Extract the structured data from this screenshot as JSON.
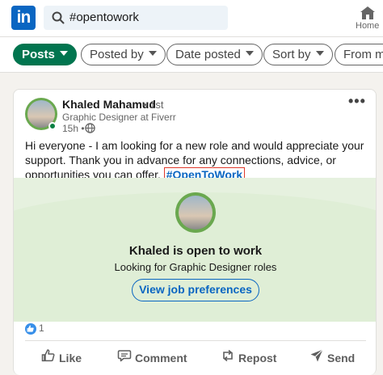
{
  "topbar": {
    "logo_text": "in",
    "search_value": "#opentowork",
    "home_label": "Home"
  },
  "filters": [
    {
      "label": "Posts",
      "active": true
    },
    {
      "label": "Posted by",
      "active": false
    },
    {
      "label": "Date posted",
      "active": false
    },
    {
      "label": "Sort by",
      "active": false
    },
    {
      "label": "From me",
      "active": false
    }
  ],
  "post": {
    "author": "Khaled Mahamud",
    "degree": "• 1st",
    "headline": "Graphic Designer at Fiverr",
    "time": "15h •",
    "more_label": "•••",
    "body_text": "Hi everyone - I am looking for a new role and would appreciate your support. Thank you in advance for any connections, advice, or opportunities you can offer.",
    "hashtag": "#OpenToWork",
    "otw": {
      "title": "Khaled is open to work",
      "subtitle": "Looking for Graphic Designer roles",
      "button": "View job preferences"
    },
    "reaction_count": "1",
    "actions": {
      "like": "Like",
      "comment": "Comment",
      "repost": "Repost",
      "send": "Send"
    }
  },
  "colors": {
    "brand": "#0a66c2",
    "active_pill": "#01754f",
    "otw_bg": "#e6f1df"
  }
}
